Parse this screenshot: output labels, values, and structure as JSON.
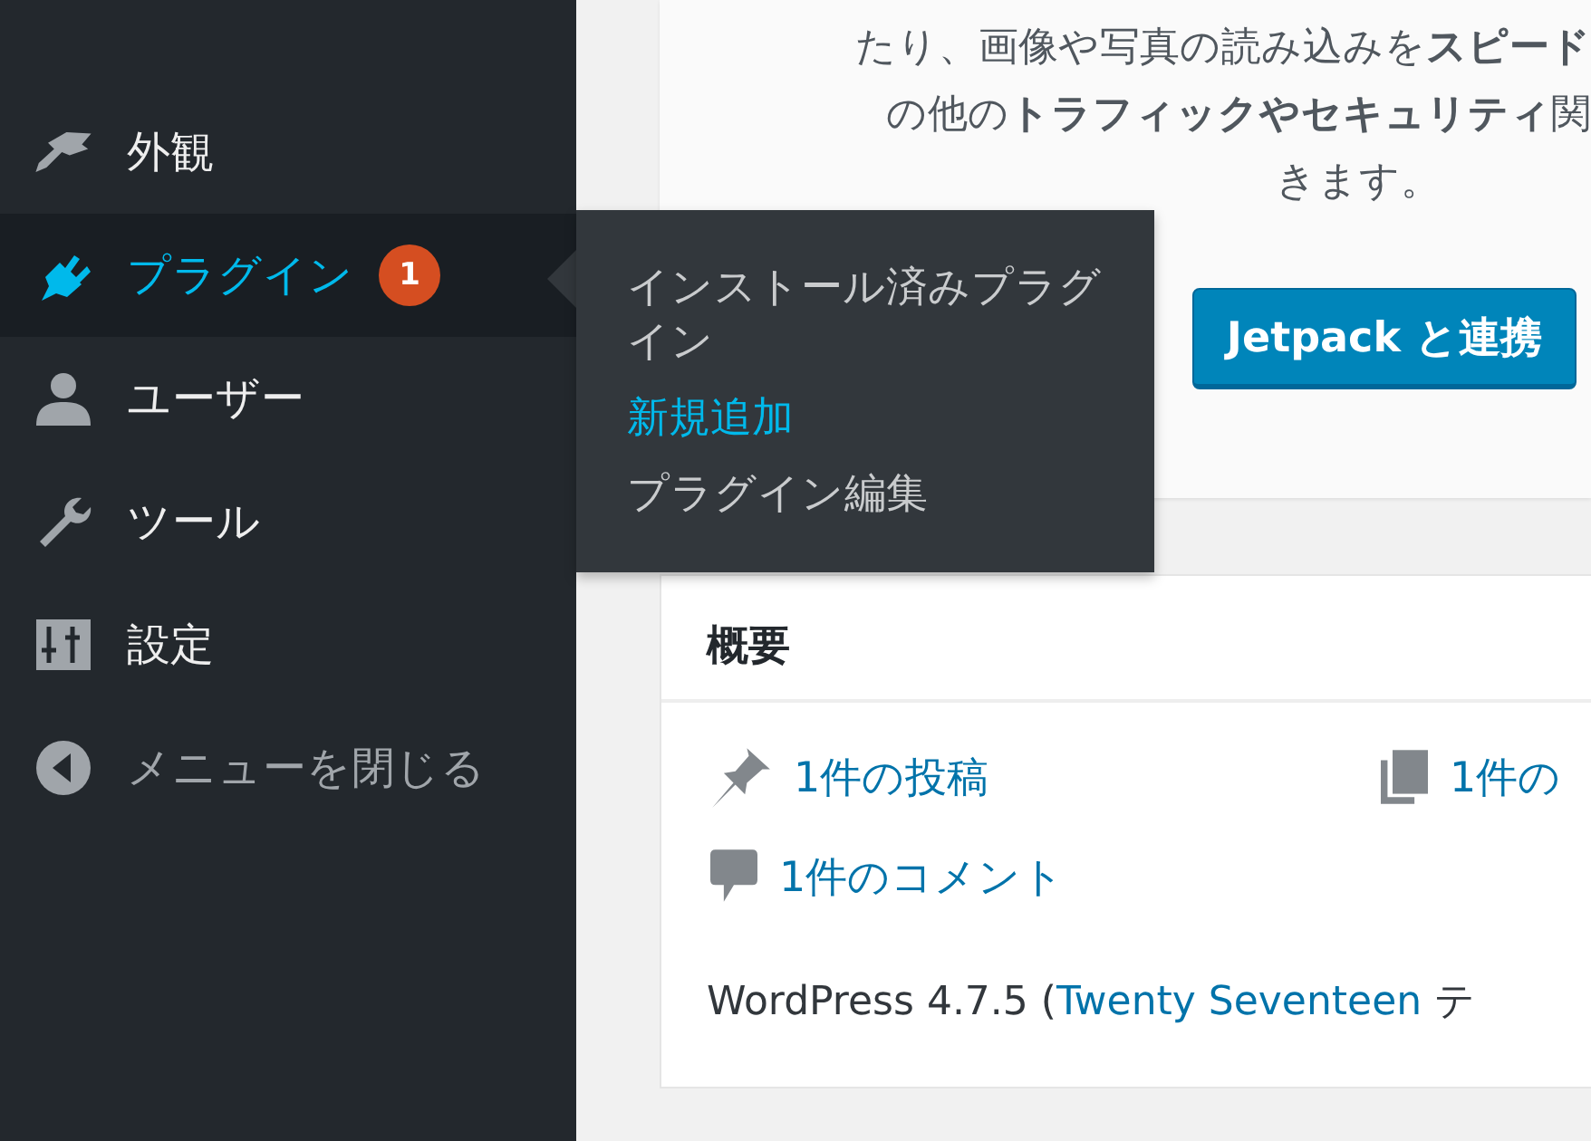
{
  "sidebar": {
    "items": [
      {
        "label": "外観",
        "kind": "link",
        "selected": false
      },
      {
        "label": "プラグイン",
        "kind": "link",
        "selected": true,
        "badge": "1",
        "submenu": [
          {
            "label": "インストール済みプラグイン",
            "selected": false
          },
          {
            "label": "新規追加",
            "selected": true
          },
          {
            "label": "プラグイン編集",
            "selected": false
          }
        ]
      },
      {
        "label": "ユーザー",
        "kind": "link",
        "selected": false
      },
      {
        "label": "ツール",
        "kind": "link",
        "selected": false
      },
      {
        "label": "設定",
        "kind": "link",
        "selected": false
      },
      {
        "label": "メニューを閉じる",
        "kind": "collapse",
        "selected": false
      }
    ]
  },
  "jetpack_card": {
    "lines": [
      "たり、画像や写真の読み込みを**スピード**",
      "の他の**トラフィックやセキュリティ**関",
      "きます。"
    ],
    "button": "Jetpack と連携"
  },
  "overview": {
    "title": "概要",
    "stats": [
      {
        "label": "1件の投稿"
      },
      {
        "label": "1件の"
      },
      {
        "label": "1件のコメント"
      }
    ],
    "footer": {
      "prefix": "WordPress 4.7.5 (",
      "theme_link": "Twenty Seventeen",
      "suffix": " テ"
    }
  }
}
